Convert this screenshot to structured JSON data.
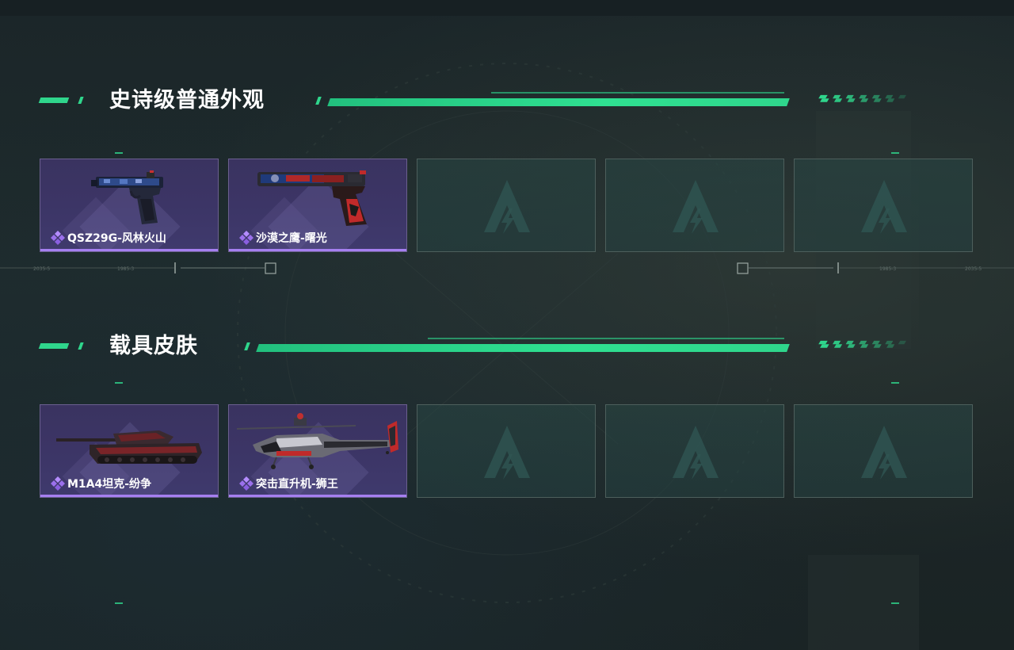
{
  "sections": [
    {
      "title": "史诗级普通外观",
      "items": [
        {
          "name": "QSZ29G-风林火山",
          "type": "pistol-qsz"
        },
        {
          "name": "沙漠之鹰-曙光",
          "type": "pistol-deagle"
        }
      ],
      "empty_slots": 3
    },
    {
      "title": "载具皮肤",
      "items": [
        {
          "name": "M1A4坦克-纷争",
          "type": "tank"
        },
        {
          "name": "突击直升机-狮王",
          "type": "helicopter"
        }
      ],
      "empty_slots": 3
    }
  ],
  "deco_labels": [
    "2035-5",
    "1985-3",
    "1985-3",
    "2035-5"
  ],
  "colors": {
    "accent": "#2fd68c",
    "rarity_epic": "#a57ff0",
    "card_bg": "#3c3566",
    "empty_slot": "#284644"
  },
  "icons": {
    "rarity": "diamond-cluster-icon",
    "empty_slot": "placeholder-logo-icon"
  }
}
